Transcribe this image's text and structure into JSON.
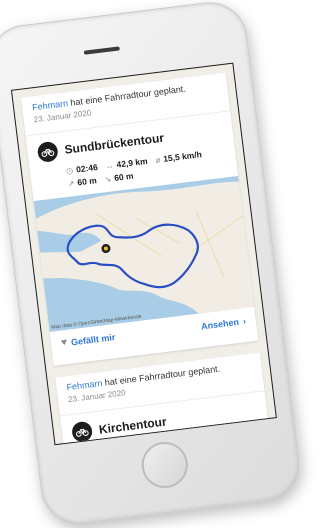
{
  "feed": {
    "card1": {
      "user": "Fehmarn",
      "action": " hat eine Fahrradtour geplant.",
      "date": "23. Januar 2020",
      "tour_title": "Sundbrückentour",
      "stats": {
        "duration": "02:46",
        "distance": "42,9 km",
        "speed": "15,5 km/h",
        "ascent": "60 m",
        "descent": "60 m"
      },
      "map_attribution": "Map data © OpenStreetMap-Mitwirkende",
      "like_label": "Gefällt mir",
      "view_label": "Ansehen"
    },
    "card2": {
      "user": "Fehmarn",
      "action": " hat eine Fahrradtour geplant.",
      "date": "23. Januar 2020",
      "tour_title": "Kirchentour"
    }
  },
  "colors": {
    "link": "#2f79d2",
    "route": "#2a4fc4",
    "sea": "#a9cde6",
    "land": "#f2ede4"
  }
}
